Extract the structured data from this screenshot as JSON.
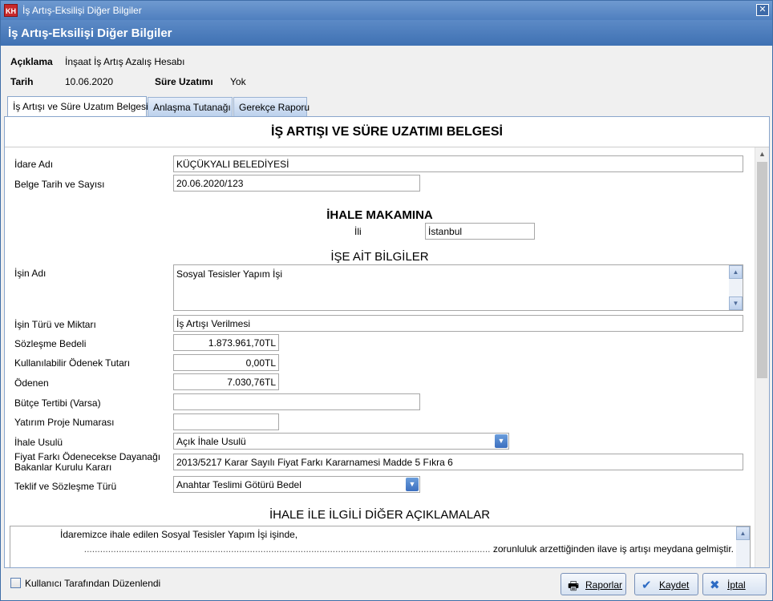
{
  "window": {
    "app_icon": "KH",
    "title": "İş Artış-Eksilişi Diğer Bilgiler",
    "close_glyph": "✕"
  },
  "header": {
    "title": "İş Artış-Eksilişi Diğer Bilgiler"
  },
  "info": {
    "aciklama_label": "Açıklama",
    "aciklama_value": "İnşaat İş Artış Azalış Hesabı",
    "tarih_label": "Tarih",
    "tarih_value": "10.06.2020",
    "sure_label": "Süre Uzatımı",
    "sure_value": "Yok"
  },
  "tabs": [
    {
      "label": "İş Artışı ve Süre Uzatım Belgesi"
    },
    {
      "label": "Anlaşma Tutanağı"
    },
    {
      "label": "Gerekçe Raporu"
    }
  ],
  "form": {
    "title": "İŞ ARTIŞI VE SÜRE UZATIMI BELGESİ",
    "idare_label": "İdare Adı",
    "idare_value": "KÜÇÜKYALI BELEDİYESİ",
    "belge_label": "Belge Tarih ve Sayısı",
    "belge_value": "20.06.2020/123",
    "ihale_makamina": "İHALE MAKAMINA",
    "ili_label": "İli",
    "ili_value": "İstanbul",
    "ise_ait": "İŞE AİT BİLGİLER",
    "isin_adi_label": "İşin Adı",
    "isin_adi_value": "Sosyal Tesisler Yapım İşi",
    "isin_turu_label": "İşin Türü ve Miktarı",
    "isin_turu_value": "İş Artışı Verilmesi",
    "sozlesme_label": "Sözleşme Bedeli",
    "sozlesme_value": "1.873.961,70TL",
    "odenek_label": "Kullanılabilir Ödenek Tutarı",
    "odenek_value": "0,00TL",
    "odenen_label": "Ödenen",
    "odenen_value": "7.030,76TL",
    "butce_label": "Bütçe Tertibi (Varsa)",
    "butce_value": "",
    "yatirim_label": "Yatırım Proje Numarası",
    "yatirim_value": "",
    "ihale_usulu_label": "İhale Usulü",
    "ihale_usulu_value": "Açık İhale Usulü",
    "fiyat_label_1": "Fiyat Farkı Ödenecekse Dayanağı",
    "fiyat_label_2": "Bakanlar Kurulu Kararı",
    "fiyat_value": "2013/5217 Karar Sayılı Fiyat Farkı Kararnamesi Madde 5 Fıkra 6",
    "teklif_label": "Teklif ve Sözleşme Türü",
    "teklif_value": "Anahtar Teslimi Götürü Bedel",
    "diger_title": "İHALE İLE İLGİLİ DİĞER AÇIKLAMALAR",
    "diger_line1": "İdaremizce ihale edilen Sosyal Tesisler Yapım İşi işinde,",
    "diger_line2": "zorunluluk arzettiğinden ilave iş artışı meydana gelmiştir."
  },
  "footer": {
    "checkbox_label": "Kullanıcı Tarafından Düzenlendi",
    "raporlar": "Raporlar",
    "kaydet": "Kaydet",
    "iptal": "İptal"
  }
}
